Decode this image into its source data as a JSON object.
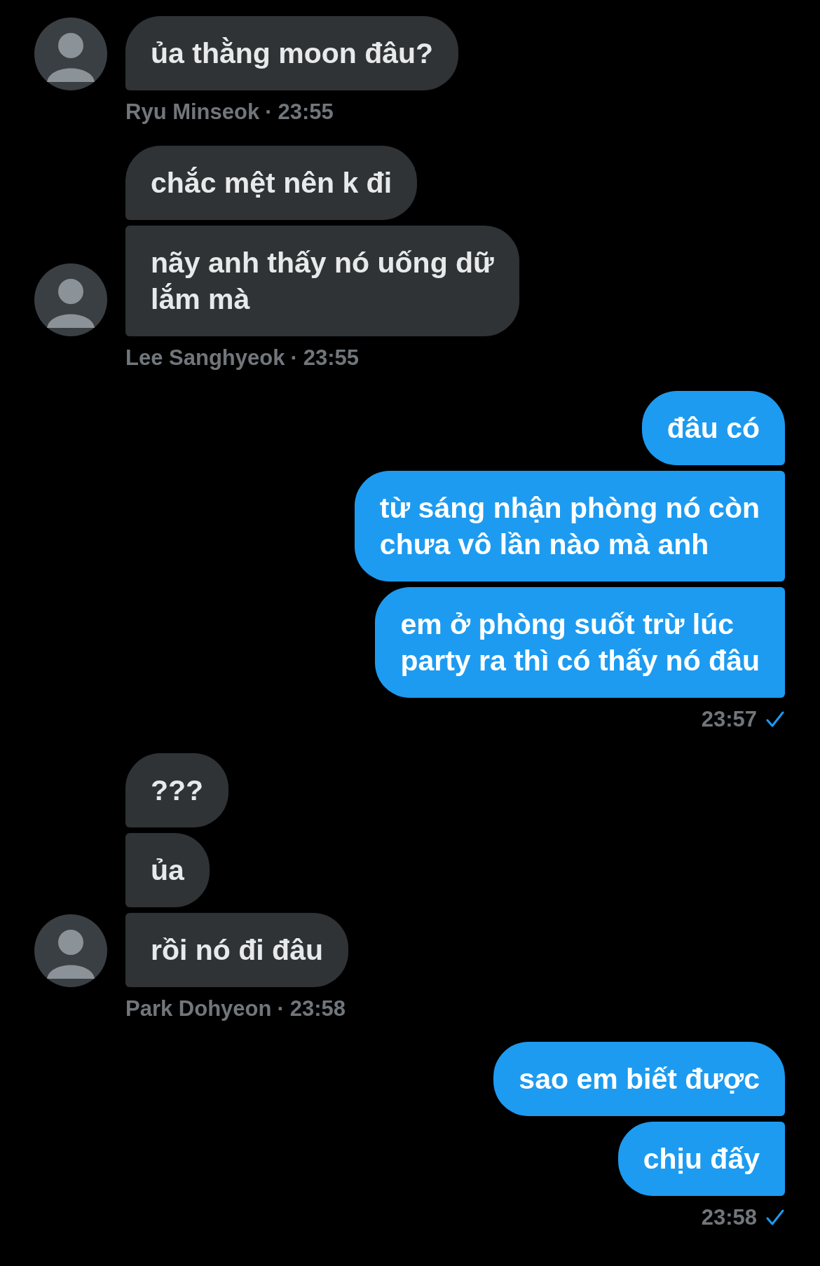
{
  "groups": [
    {
      "kind": "incoming",
      "messages": [
        "ủa thằng moon đâu?"
      ],
      "sender": "Ryu Minseok",
      "separator": "·",
      "time": "23:55"
    },
    {
      "kind": "incoming",
      "messages": [
        "chắc mệt nên k đi",
        "nãy anh thấy nó uống dữ\nlắm mà"
      ],
      "sender": "Lee Sanghyeok",
      "separator": "·",
      "time": "23:55"
    },
    {
      "kind": "outgoing",
      "messages": [
        "đâu có",
        "từ sáng nhận phòng nó còn\nchưa vô lần nào mà anh",
        "em ở phòng suốt trừ lúc\nparty ra thì có thấy nó đâu"
      ],
      "time": "23:57",
      "read": true
    },
    {
      "kind": "incoming",
      "messages": [
        "???",
        "ủa",
        "rồi nó đi đâu"
      ],
      "sender": "Park Dohyeon",
      "separator": "·",
      "time": "23:58"
    },
    {
      "kind": "outgoing",
      "messages": [
        "sao em biết được",
        "chịu đấy"
      ],
      "time": "23:58",
      "read": true
    }
  ]
}
